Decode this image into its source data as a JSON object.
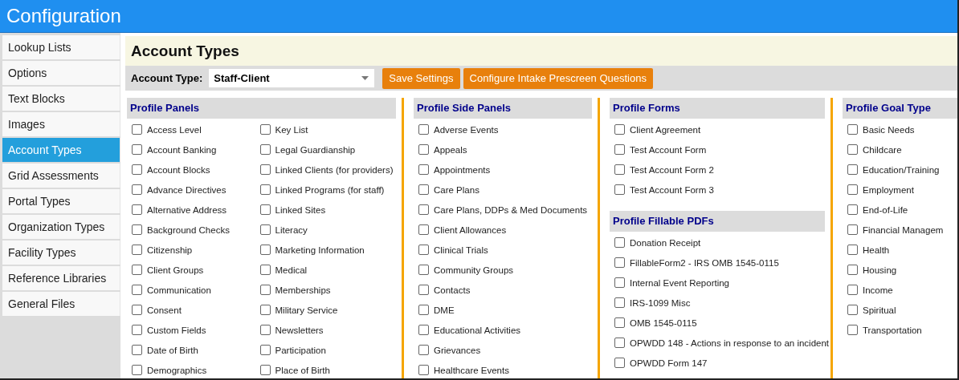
{
  "window": {
    "title": "Configuration"
  },
  "sidebar": {
    "items": [
      {
        "label": "Lookup Lists",
        "selected": false
      },
      {
        "label": "Options",
        "selected": false
      },
      {
        "label": "Text Blocks",
        "selected": false
      },
      {
        "label": "Images",
        "selected": false
      },
      {
        "label": "Account Types",
        "selected": true
      },
      {
        "label": "Grid Assessments",
        "selected": false
      },
      {
        "label": "Portal Types",
        "selected": false
      },
      {
        "label": "Organization Types",
        "selected": false
      },
      {
        "label": "Facility Types",
        "selected": false
      },
      {
        "label": "Reference Libraries",
        "selected": false
      },
      {
        "label": "General Files",
        "selected": false
      }
    ]
  },
  "page_title": "Account Types",
  "toolbar": {
    "account_type_label": "Account Type:",
    "account_type_value": "Staff-Client",
    "buttons": [
      "Save Settings",
      "Configure Intake Prescreen Questions"
    ]
  },
  "columns": [
    {
      "sections": [
        {
          "title": "Profile Panels",
          "item_columns": [
            [
              {
                "label": "Access Level",
                "checked": false
              },
              {
                "label": "Account Banking",
                "checked": false
              },
              {
                "label": "Account Blocks",
                "checked": false
              },
              {
                "label": "Advance Directives",
                "checked": false
              },
              {
                "label": "Alternative Address",
                "checked": false
              },
              {
                "label": "Background Checks",
                "checked": false
              },
              {
                "label": "Citizenship",
                "checked": false
              },
              {
                "label": "Client Groups",
                "checked": false
              },
              {
                "label": "Communication",
                "checked": false
              },
              {
                "label": "Consent",
                "checked": false
              },
              {
                "label": "Custom Fields",
                "checked": false
              },
              {
                "label": "Date of Birth",
                "checked": false
              },
              {
                "label": "Demographics",
                "checked": false
              }
            ],
            [
              {
                "label": "Key List",
                "checked": false
              },
              {
                "label": "Legal Guardianship",
                "checked": false
              },
              {
                "label": "Linked Clients (for providers)",
                "checked": false
              },
              {
                "label": "Linked Programs (for staff)",
                "checked": false
              },
              {
                "label": "Linked Sites",
                "checked": false
              },
              {
                "label": "Literacy",
                "checked": false
              },
              {
                "label": "Marketing Information",
                "checked": false
              },
              {
                "label": "Medical",
                "checked": false
              },
              {
                "label": "Memberships",
                "checked": false
              },
              {
                "label": "Military Service",
                "checked": false
              },
              {
                "label": "Newsletters",
                "checked": false
              },
              {
                "label": "Participation",
                "checked": false
              },
              {
                "label": "Place of Birth",
                "checked": false
              }
            ]
          ]
        }
      ]
    },
    {
      "sections": [
        {
          "title": "Profile Side Panels",
          "item_columns": [
            [
              {
                "label": "Adverse Events",
                "checked": false
              },
              {
                "label": "Appeals",
                "checked": false
              },
              {
                "label": "Appointments",
                "checked": false
              },
              {
                "label": "Care Plans",
                "checked": false
              },
              {
                "label": "Care Plans, DDPs & Med Documents",
                "checked": false
              },
              {
                "label": "Client Allowances",
                "checked": false
              },
              {
                "label": "Clinical Trials",
                "checked": false
              },
              {
                "label": "Community Groups",
                "checked": false
              },
              {
                "label": "Contacts",
                "checked": false
              },
              {
                "label": "DME",
                "checked": false
              },
              {
                "label": "Educational Activities",
                "checked": false
              },
              {
                "label": "Grievances",
                "checked": false
              },
              {
                "label": "Healthcare Events",
                "checked": false
              }
            ]
          ]
        }
      ]
    },
    {
      "sections": [
        {
          "title": "Profile Forms",
          "item_columns": [
            [
              {
                "label": "Client Agreement",
                "checked": false
              },
              {
                "label": "Test Account Form",
                "checked": false
              },
              {
                "label": "Test Account Form 2",
                "checked": false
              },
              {
                "label": "Test Account Form 3",
                "checked": false
              }
            ]
          ]
        },
        {
          "title": "Profile Fillable PDFs",
          "item_columns": [
            [
              {
                "label": "Donation Receipt",
                "checked": false
              },
              {
                "label": "FillableForm2 - IRS OMB 1545-0115",
                "checked": false
              },
              {
                "label": "Internal Event Reporting",
                "checked": false
              },
              {
                "label": "IRS-1099 Misc",
                "checked": false
              },
              {
                "label": "OMB 1545-0115",
                "checked": false
              },
              {
                "label": "OPWDD 148 - Actions in response to an incident",
                "checked": false
              },
              {
                "label": "OPWDD Form 147",
                "checked": false
              }
            ]
          ]
        }
      ]
    },
    {
      "sections": [
        {
          "title": "Profile Goal Type",
          "item_columns": [
            [
              {
                "label": "Basic Needs",
                "checked": false
              },
              {
                "label": "Childcare",
                "checked": false
              },
              {
                "label": "Education/Training",
                "checked": false
              },
              {
                "label": "Employment",
                "checked": false
              },
              {
                "label": "End-of-Life",
                "checked": false
              },
              {
                "label": "Financial Managem",
                "checked": false
              },
              {
                "label": "Health",
                "checked": false
              },
              {
                "label": "Housing",
                "checked": false
              },
              {
                "label": "Income",
                "checked": false
              },
              {
                "label": "Spiritual",
                "checked": false
              },
              {
                "label": "Transportation",
                "checked": false
              }
            ]
          ]
        }
      ]
    }
  ]
}
